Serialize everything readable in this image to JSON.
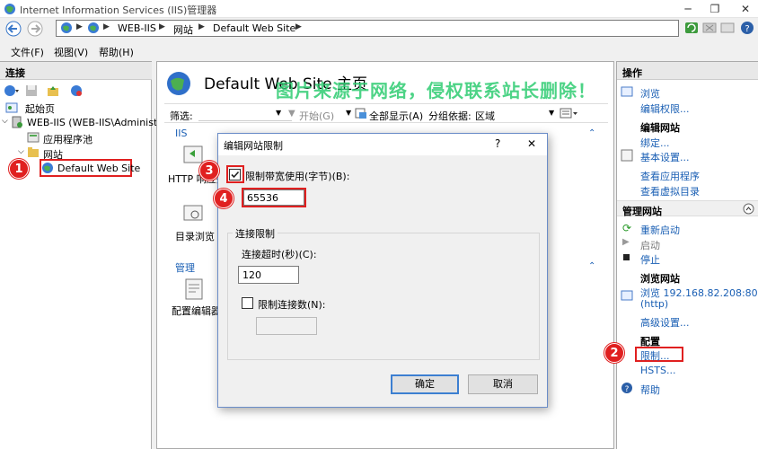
{
  "window": {
    "title": "Internet Information Services (IIS)管理器"
  },
  "address": {
    "crumbs": [
      "WEB-IIS",
      "网站",
      "Default Web Site"
    ]
  },
  "menu": {
    "file": "文件(F)",
    "view": "视图(V)",
    "help": "帮助(H)"
  },
  "connections": {
    "header": "连接",
    "tree": {
      "start": "起始页",
      "server": "WEB-IIS (WEB-IIS\\Administr",
      "apppools": "应用程序池",
      "sites": "网站",
      "site": "Default Web Site"
    }
  },
  "center": {
    "title": "Default Web Site 主页",
    "watermark": "图片来源于网络，侵权联系站长删除！",
    "filter_label": "筛选:",
    "start_btn": "开始(G)",
    "show_all": "全部显示(A)",
    "group_by": "分组依据:",
    "group_value": "区域",
    "section_iis": "IIS",
    "section_manage": "管理",
    "icons": {
      "http": "HTTP 响应头",
      "dirbrowse": "目录浏览",
      "config": "配置编辑器"
    }
  },
  "actions": {
    "header": "操作",
    "browse": "浏览",
    "edit_perms": "编辑权限...",
    "edit_site_header": "编辑网站",
    "bindings": "绑定...",
    "basic_settings": "基本设置...",
    "view_apps": "查看应用程序",
    "view_vdirs": "查看虚拟目录",
    "manage_site_header": "管理网站",
    "restart": "重新启动",
    "start": "启动",
    "stop": "停止",
    "browse_site_header": "浏览网站",
    "browse_addr_line1": "浏览 192.168.82.208:80",
    "browse_addr_line2": "(http)",
    "advanced": "高级设置...",
    "config_header": "配置",
    "limits": "限制...",
    "hsts": "HSTS...",
    "help": "帮助"
  },
  "dialog": {
    "title": "编辑网站限制",
    "help_glyph": "?",
    "close_glyph": "✕",
    "bandwidth_label": "限制带宽使用(字节)(B):",
    "bandwidth_checked": true,
    "bandwidth_value": "65536",
    "conn_group": "连接限制",
    "timeout_label": "连接超时(秒)(C):",
    "timeout_value": "120",
    "limit_conn_label": "限制连接数(N):",
    "limit_conn_checked": false,
    "limit_conn_value": "",
    "ok": "确定",
    "cancel": "取消"
  },
  "annotations": [
    "1",
    "2",
    "3",
    "4"
  ],
  "colors": {
    "accent_red": "#e02020",
    "link": "#1a5fb4",
    "watermark": "#2ecc71"
  }
}
